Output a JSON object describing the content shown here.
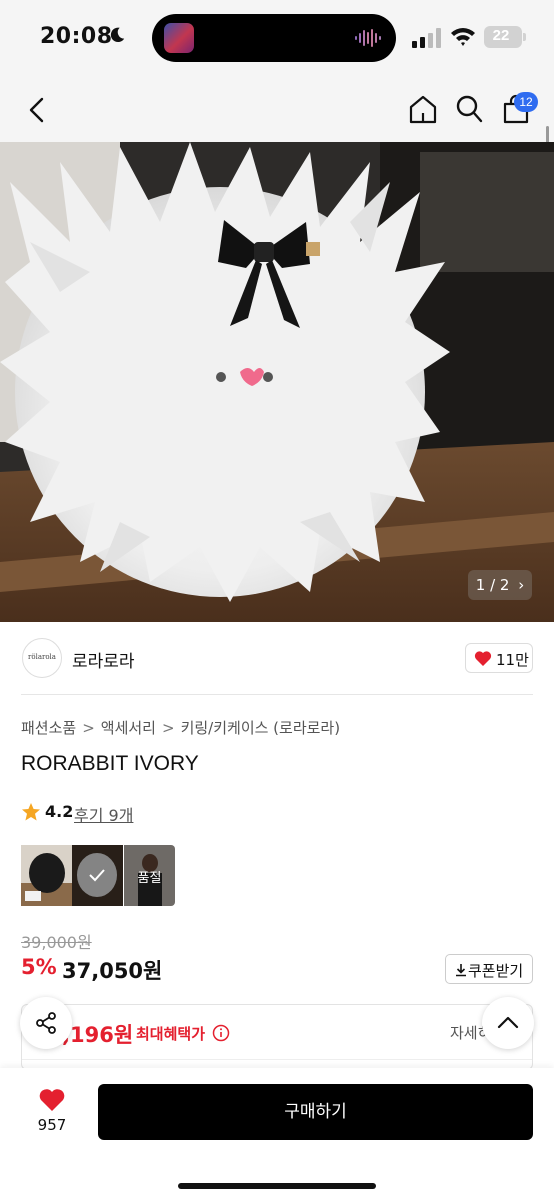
{
  "status_bar": {
    "time": "20:08",
    "battery": "22",
    "icons": [
      "moon-icon",
      "audio-wave-icon",
      "signal-icon",
      "wifi-icon",
      "battery-icon"
    ]
  },
  "header": {
    "cart_count": "12",
    "icons": [
      "back-arrow-icon",
      "home-icon",
      "search-icon",
      "cart-icon"
    ]
  },
  "product_image": {
    "counter": "1 / 2"
  },
  "brand": {
    "logo_text": "rölarola",
    "name": "로라로라",
    "like_count": "11만"
  },
  "breadcrumb": [
    "패션소품",
    "액세서리",
    "키링/키케이스 (로라로라)"
  ],
  "product": {
    "title": "RORABBIT IVORY",
    "rating": "4.2",
    "review_link": "후기 9개",
    "soldout_label": "품절"
  },
  "price": {
    "original": "39,000원",
    "discount": "5%",
    "sale": "37,050원",
    "coupon_label": "쿠폰받기"
  },
  "benefit": {
    "price": ",196원",
    "label": "최대혜택가",
    "detail_link": "자세히"
  },
  "bottom_bar": {
    "wish_count": "957",
    "buy_label": "구매하기"
  },
  "colors": {
    "accent_red": "#e4202f",
    "badge_blue": "#2f6cf0",
    "buy_button": "#000000"
  }
}
